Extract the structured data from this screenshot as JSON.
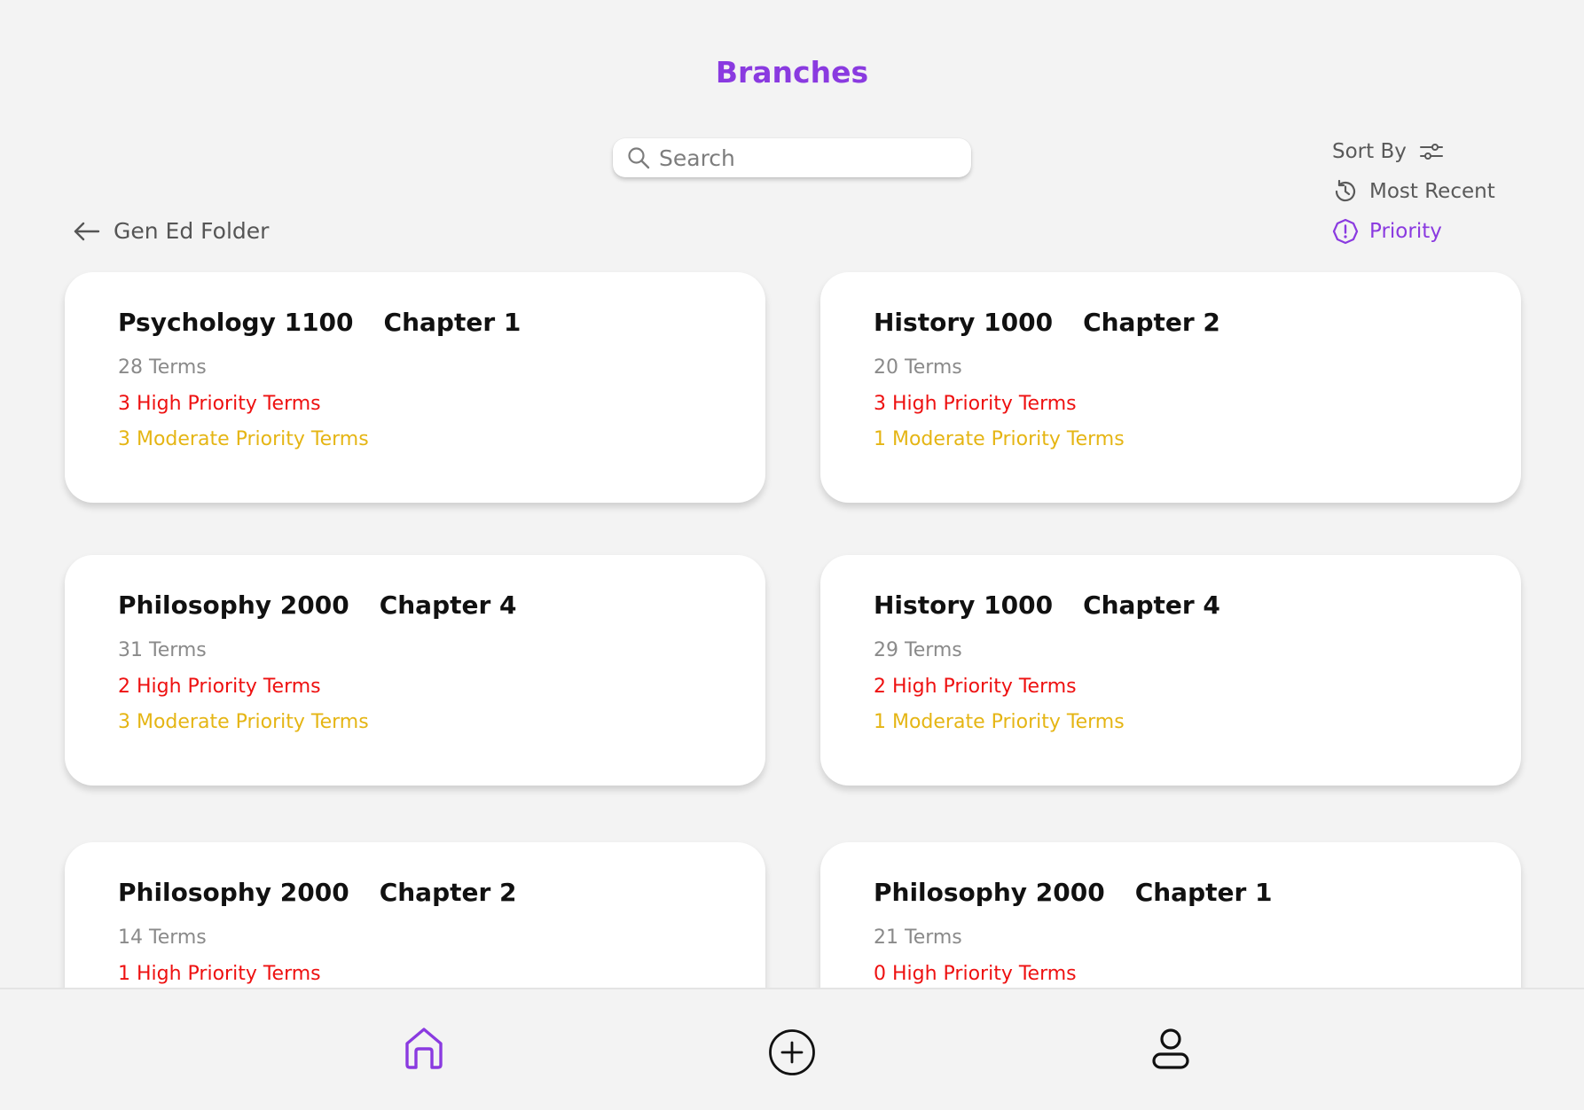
{
  "header": {
    "title": "Branches"
  },
  "search": {
    "placeholder": "Search",
    "icon": "search-icon"
  },
  "sort": {
    "label": "Sort By",
    "options": [
      {
        "label": "Most Recent",
        "icon": "history-icon",
        "selected": false
      },
      {
        "label": "Priority",
        "icon": "priority-alert-icon",
        "selected": true
      }
    ]
  },
  "breadcrumb": {
    "label": "Gen Ed Folder",
    "icon": "arrow-left-icon"
  },
  "cards": [
    {
      "course": "Psychology 1100",
      "chapter": "Chapter 1",
      "terms": "28 Terms",
      "high": "3 High Priority Terms",
      "moderate": "3 Moderate Priority Terms"
    },
    {
      "course": "History 1000",
      "chapter": "Chapter 2",
      "terms": "20 Terms",
      "high": "3 High Priority Terms",
      "moderate": "1 Moderate Priority Terms"
    },
    {
      "course": "Philosophy 2000",
      "chapter": "Chapter 4",
      "terms": "31 Terms",
      "high": "2 High Priority Terms",
      "moderate": "3 Moderate Priority Terms"
    },
    {
      "course": "History 1000",
      "chapter": "Chapter 4",
      "terms": "29 Terms",
      "high": "2 High Priority Terms",
      "moderate": "1 Moderate Priority Terms"
    },
    {
      "course": "Philosophy 2000",
      "chapter": "Chapter 2",
      "terms": "14 Terms",
      "high": "1 High Priority Terms",
      "moderate": ""
    },
    {
      "course": "Philosophy 2000",
      "chapter": "Chapter 1",
      "terms": "21 Terms",
      "high": "0 High Priority Terms",
      "moderate": ""
    }
  ],
  "nav": {
    "items": [
      {
        "icon": "home-icon",
        "active": true
      },
      {
        "icon": "add-circle-icon",
        "active": false
      },
      {
        "icon": "profile-icon",
        "active": false
      }
    ]
  },
  "colors": {
    "accent": "#8a3ae0",
    "high_priority": "#ee1111",
    "moderate_priority": "#e5b514",
    "muted": "#8a8a8a",
    "background": "#f3f3f3"
  }
}
